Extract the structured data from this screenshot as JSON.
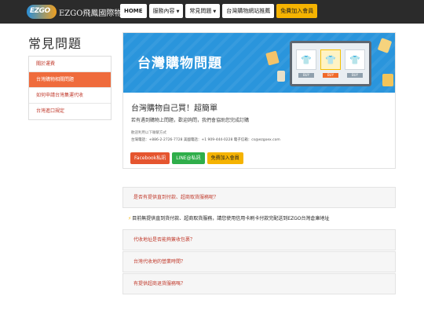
{
  "header": {
    "logo_mark": "EZGO",
    "logo_text": "EZGO飛鳳國際物流",
    "nav": [
      {
        "label": "HOME"
      },
      {
        "label": "服務內容",
        "caret": "▼"
      },
      {
        "label": "常見問題",
        "caret": "▼"
      },
      {
        "label": "台灣購物網站推薦"
      },
      {
        "label": "免費加入會員"
      }
    ]
  },
  "page_title": "常見問題",
  "sidebar": {
    "items": [
      {
        "label": "關於運費"
      },
      {
        "label": "台灣購物相關問題"
      },
      {
        "label": "如何申請台灣集運代收"
      },
      {
        "label": "台灣進口規定"
      }
    ]
  },
  "banner": {
    "title": "台灣購物問題",
    "buy_label": "BUY",
    "shirt_icon": "shirt-icon"
  },
  "card": {
    "heading": "台灣購物自己買！超簡單",
    "subtitle": "若有遇到購物上問題，歡迎詢問，我們會協助您完成訂購",
    "contact_label": "歡迎利用以下聯繫方式",
    "contact_line": "台灣電話：+886-2-2726-7728 美國電話：+1 909-444-0228 電子信箱：cs@ezgoex.com",
    "buttons": {
      "facebook": "Facebook私訊",
      "line": "LINE@私訊",
      "join": "免費加入會員"
    }
  },
  "faq": {
    "items": [
      {
        "question": "是否有提供直到付款、超商取貨服務呢？"
      },
      {
        "question": "代收地址是否能夠簽收包裹？"
      },
      {
        "question": "台灣代收地的營業時間？"
      },
      {
        "question": "有提供超商退貨服務嗎？"
      }
    ],
    "answer": "目前無提供直到貨付款、超商取貨服務，請您使用信用卡刷卡付款完配送到EZGO台灣倉庫地址",
    "answer_icon": "⚡"
  },
  "colors": {
    "accent": "#ef6b3c",
    "banner": "#2a95dc",
    "cta": "#f5b301",
    "link": "#c0392b"
  }
}
